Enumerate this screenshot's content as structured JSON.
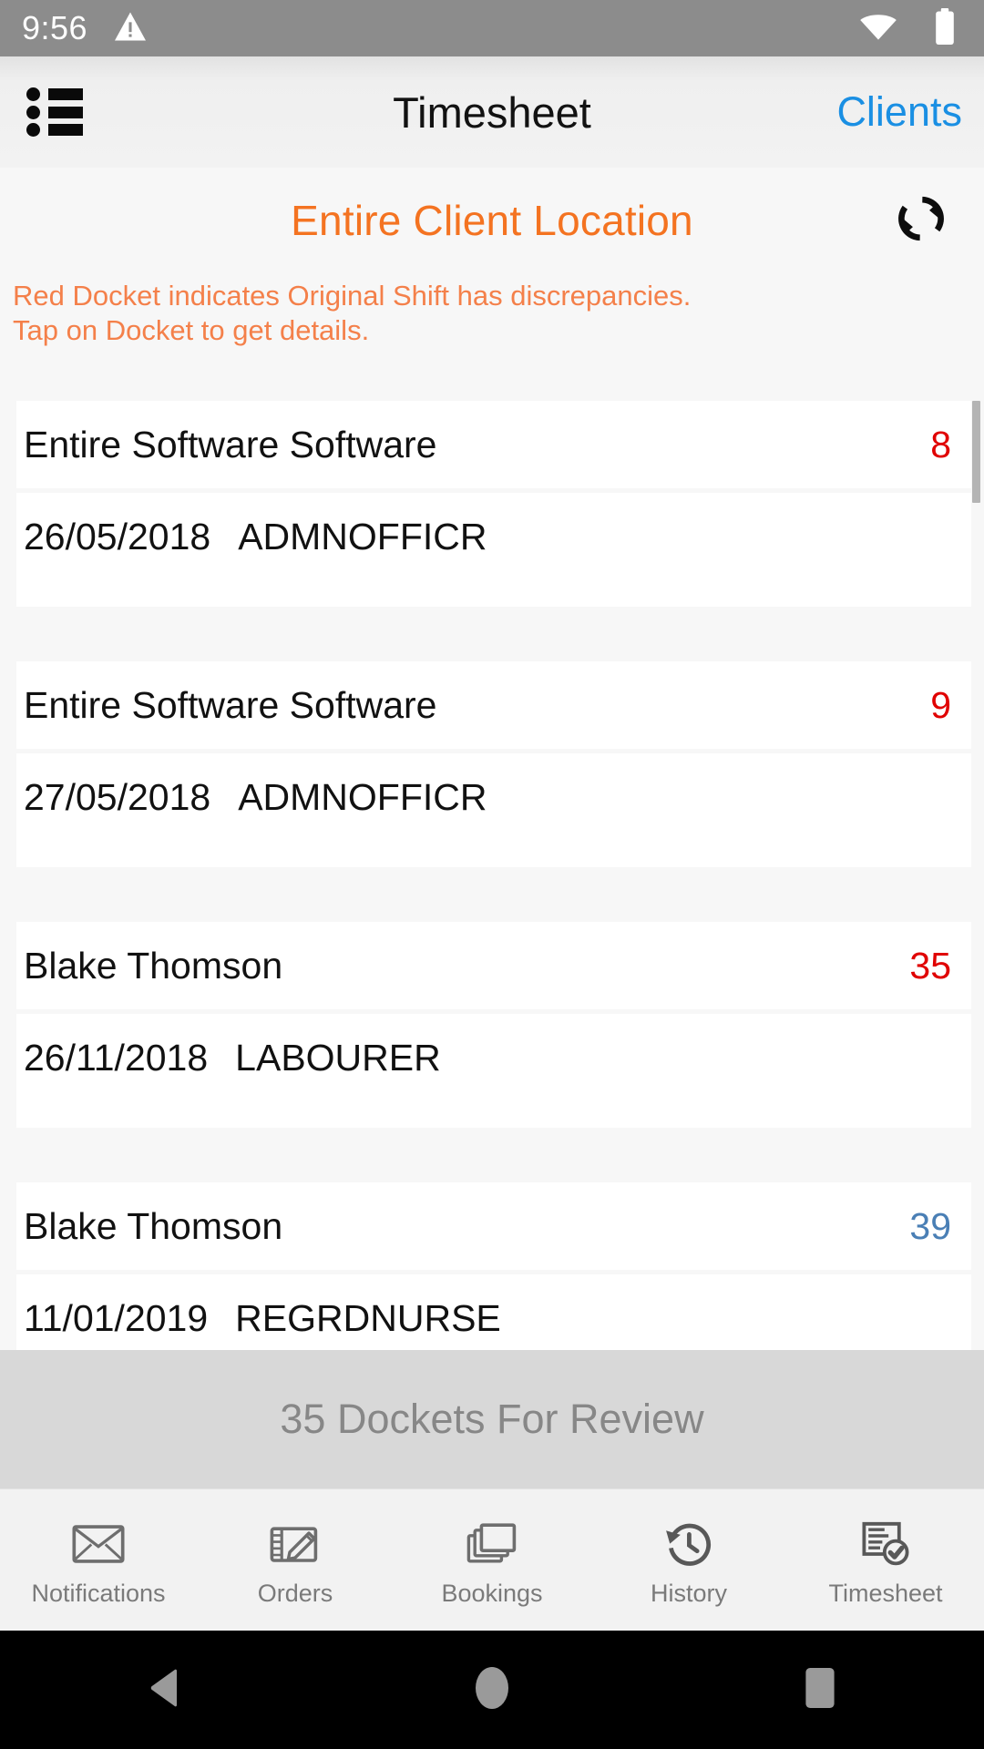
{
  "statusbar": {
    "time": "9:56",
    "warning_icon": "warning-triangle-icon",
    "wifi_icon": "wifi-icon",
    "battery_icon": "battery-icon"
  },
  "navbar": {
    "menu_icon": "bulleted-list-menu-icon",
    "title": "Timesheet",
    "right_action": "Clients",
    "right_action_color": "#1a8fe3"
  },
  "header": {
    "section_title": "Entire Client Location",
    "section_title_color": "#f47321",
    "refresh_icon": "sync-refresh-icon",
    "hint_line1": "Red Docket indicates Original Shift has discrepancies.",
    "hint_line2": "Tap on Docket to get details.",
    "hint_color": "#f4804a"
  },
  "colors": {
    "red": "#e00000",
    "blue": "#4a7fb5",
    "orange": "#f47321",
    "background": "#f7f7f7",
    "card": "#ffffff"
  },
  "dockets": [
    {
      "name": "Entire Software Software",
      "count": "8",
      "count_color": "#e00000",
      "date": "26/05/2018",
      "role": "ADMNOFFICR"
    },
    {
      "name": "Entire Software Software",
      "count": "9",
      "count_color": "#e00000",
      "date": "27/05/2018",
      "role": "ADMNOFFICR"
    },
    {
      "name": "Blake Thomson",
      "count": "35",
      "count_color": "#e00000",
      "date": "26/11/2018",
      "role": "LABOURER"
    },
    {
      "name": "Blake Thomson",
      "count": "39",
      "count_color": "#4a7fb5",
      "date": "11/01/2019",
      "role": "REGRDNURSE"
    }
  ],
  "review_bar": {
    "label": "35 Dockets For Review"
  },
  "tabs": [
    {
      "label": "Notifications",
      "icon": "envelope-icon",
      "active": false
    },
    {
      "label": "Orders",
      "icon": "tablet-pencil-icon",
      "active": false
    },
    {
      "label": "Bookings",
      "icon": "stacked-windows-icon",
      "active": false
    },
    {
      "label": "History",
      "icon": "clock-rewind-icon",
      "active": false
    },
    {
      "label": "Timesheet",
      "icon": "document-check-icon",
      "active": true
    }
  ],
  "androidnav": {
    "back_icon": "back-triangle-icon",
    "home_icon": "home-circle-icon",
    "recents_icon": "recents-square-icon"
  }
}
